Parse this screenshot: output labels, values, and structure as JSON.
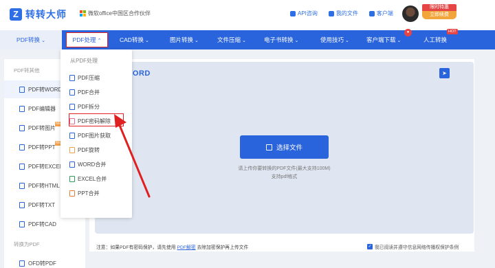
{
  "header": {
    "logo_mark": "Z",
    "logo_text": "转转大师",
    "partner": "微软office中国区合作伙伴",
    "links": [
      {
        "label": "API咨询"
      },
      {
        "label": "我的文件"
      },
      {
        "label": "客户端"
      }
    ],
    "promo_top": "限时特惠",
    "promo_bottom": "立即续费"
  },
  "nav": {
    "items": [
      "PDF转换",
      "PDF处理",
      "CAD转换",
      "图片转换",
      "文件压缩",
      "电子书转换",
      "使用技巧",
      "客户端下载",
      "人工转换"
    ],
    "hot_badge": "HOT"
  },
  "sidebar": {
    "section1": "PDF转其他",
    "items": [
      "PDF转WORD",
      "PDF编辑器",
      "PDF转图片",
      "PDF转PPT",
      "PDF转EXCEL",
      "PDF转HTML",
      "PDF转TXT",
      "PDF转CAD"
    ],
    "new_badge": "NEW",
    "section2": "转换为PDF",
    "items2": [
      "OFD转PDF"
    ]
  },
  "dropdown": {
    "heading": "从PDF处理",
    "items": [
      "PDF压缩",
      "PDF合并",
      "PDF拆分",
      "PDF密码解除",
      "PDF图片获取",
      "PDF旋转",
      "WORD合并",
      "EXCEL合并",
      "PPT合并"
    ]
  },
  "main": {
    "title": "WORD",
    "select_button": "选择文件",
    "hint1": "请上传你要转换的PDF文件(最大支持100M)",
    "hint2": "支持pdf格式",
    "footer_prefix": "注意：如果PDF有密码保护，请先使用",
    "footer_link": "PDF解密",
    "footer_suffix": "去除加密保护再上传文件",
    "agree": "我已阅读并遵守信息网络传播权保护条例"
  }
}
